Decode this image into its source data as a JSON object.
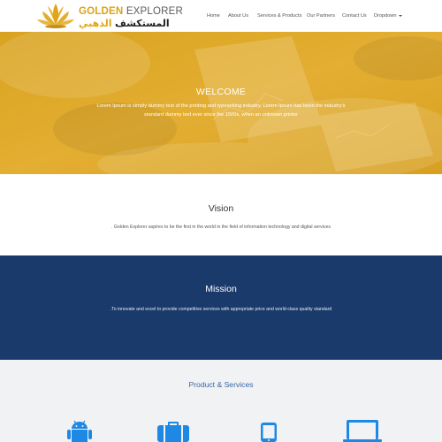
{
  "brand": {
    "name_en_word1": "GOLDEN",
    "name_en_word2": "EXPLORER",
    "name_ar_word1": "المستكشف",
    "name_ar_word2": "الذهبي"
  },
  "nav": {
    "items": [
      {
        "label": "Home"
      },
      {
        "label": "About Us"
      },
      {
        "label": "Services & Products"
      },
      {
        "label": "Our Partners"
      },
      {
        "label": "Contact Us"
      },
      {
        "label": "Dropdown"
      }
    ]
  },
  "hero": {
    "title": "WELCOME",
    "text": "Lorem Ipsum is simply dummy text of the printing and typesetting industry. Lorem Ipsum has been the industry's standard dummy text ever since the 1500s, when an unknown printer"
  },
  "vision": {
    "title": "Vision",
    "text": ". Golden Explorer aspires to be the first in the world in the field of information technology and digital services"
  },
  "mission": {
    "title": "Mission",
    "text": ".To innovate and excel to provide competitive services with appropriate price and world-class quality standard"
  },
  "products": {
    "title": "Product & Services",
    "icons": [
      "android-icon",
      "briefcase-icon",
      "mobile-phone-icon",
      "laptop-icon"
    ]
  },
  "colors": {
    "hero_gold": "#dfa825",
    "mission_navy": "#1a3a6b",
    "product_icon_blue": "#1e88e5",
    "products_title_blue": "#3a66a6"
  }
}
